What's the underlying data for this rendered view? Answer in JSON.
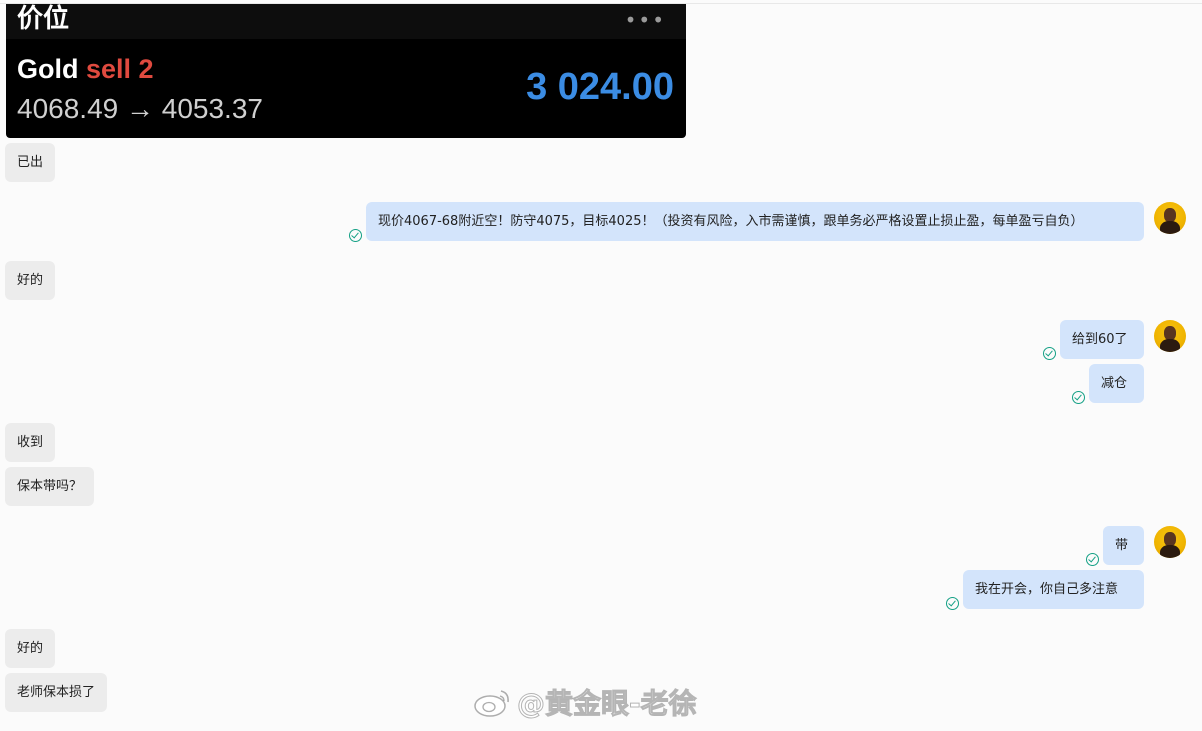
{
  "trade_card": {
    "title": "价位",
    "menu": "•••",
    "symbol": "Gold",
    "side_label": "sell 2",
    "price_move": "4068.49 → 4053.37",
    "profit": "3 024.00"
  },
  "messages": [
    {
      "id": "m1",
      "dir": "in",
      "text": "已出"
    },
    {
      "id": "m2",
      "dir": "out",
      "text": "现价4067-68附近空！防守4075，目标4025！（投资有风险，入市需谨慎，跟单务必严格设置止损止盈，每单盈亏自负）"
    },
    {
      "id": "m3",
      "dir": "in",
      "text": "好的"
    },
    {
      "id": "m4",
      "dir": "out",
      "text": "给到60了"
    },
    {
      "id": "m5",
      "dir": "out",
      "text": "减仓"
    },
    {
      "id": "m6",
      "dir": "in",
      "text": "收到"
    },
    {
      "id": "m7",
      "dir": "in",
      "text": "保本带吗？"
    },
    {
      "id": "m8",
      "dir": "out",
      "text": "带"
    },
    {
      "id": "m9",
      "dir": "out",
      "text": "我在开会，你自己多注意"
    },
    {
      "id": "m10",
      "dir": "in",
      "text": "好的"
    },
    {
      "id": "m11",
      "dir": "in",
      "text": "老师保本损了"
    }
  ],
  "watermark": {
    "text": "@黄金眼-老徐"
  },
  "colors": {
    "incoming_bubble": "#ececec",
    "outgoing_bubble": "#d3e4fb",
    "read_check": "#14a085",
    "sell_red": "#e04a3f",
    "profit_blue": "#3b8ce3"
  }
}
